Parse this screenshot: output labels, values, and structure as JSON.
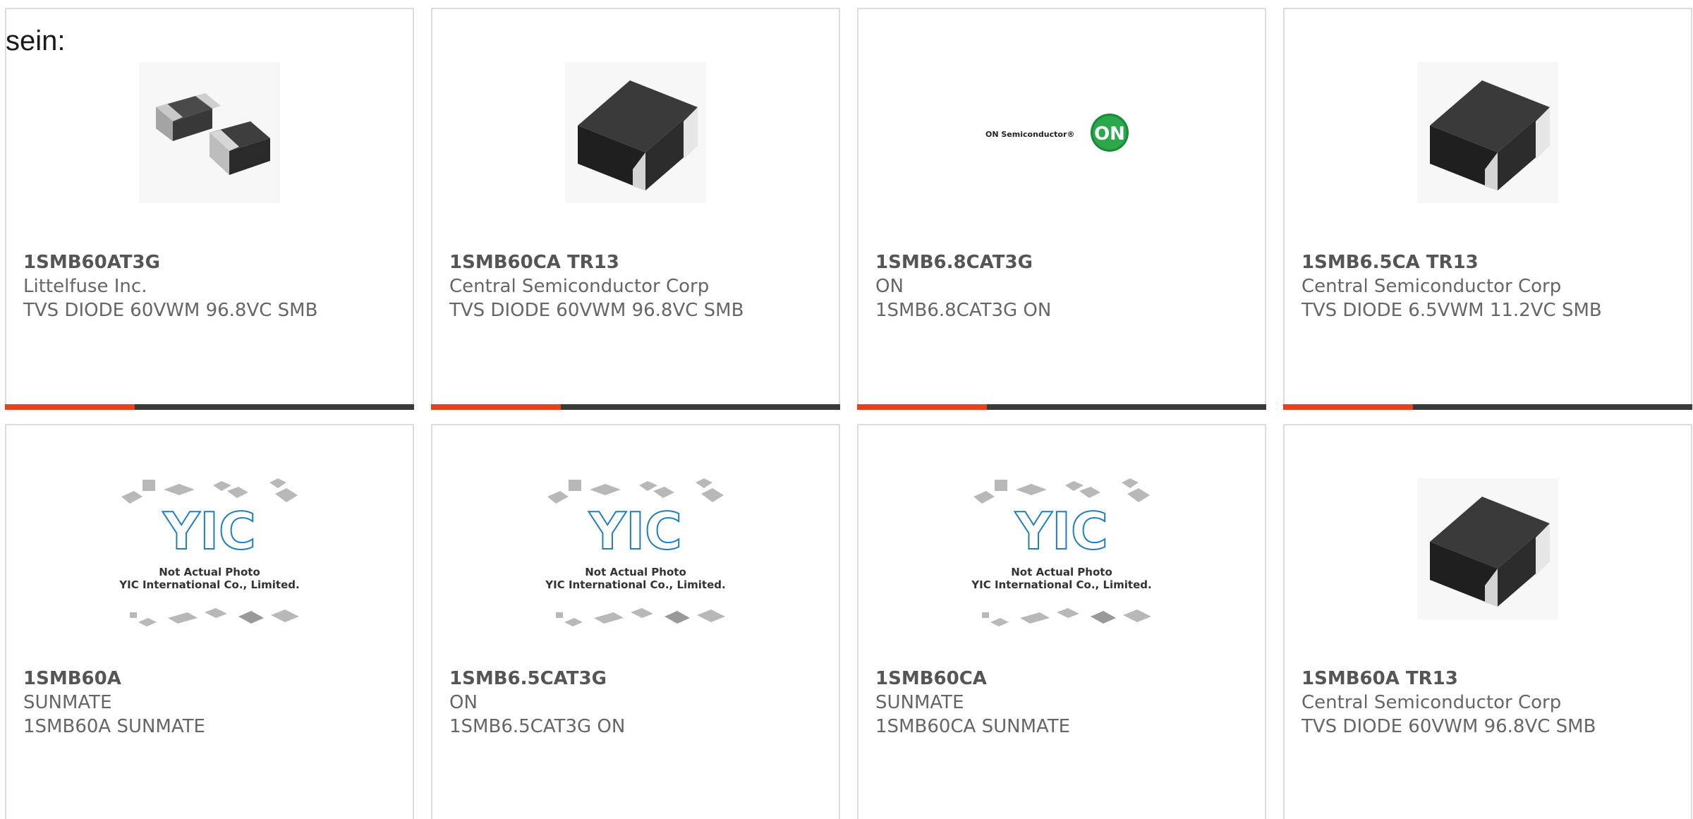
{
  "intro_text": "sein:",
  "products": [
    {
      "part_number": "1SMB60AT3G",
      "manufacturer": "Littelfuse Inc.",
      "description": "TVS DIODE 60VWM 96.8VC SMB",
      "image": "smb-diode-pair"
    },
    {
      "part_number": "1SMB60CA TR13",
      "manufacturer": "Central Semiconductor Corp",
      "description": "TVS DIODE 60VWM 96.8VC SMB",
      "image": "smb-diode-single"
    },
    {
      "part_number": "1SMB6.8CAT3G",
      "manufacturer": "ON",
      "description": "1SMB6.8CAT3G ON",
      "image": "on-semiconductor-logo",
      "logo_text": "ON Semiconductor®",
      "logo_badge": "ON"
    },
    {
      "part_number": "1SMB6.5CA TR13",
      "manufacturer": "Central Semiconductor Corp",
      "description": "TVS DIODE 6.5VWM 11.2VC SMB",
      "image": "smb-diode-single"
    },
    {
      "part_number": "1SMB60A",
      "manufacturer": "SUNMATE",
      "description": "1SMB60A SUNMATE",
      "image": "yic-placeholder"
    },
    {
      "part_number": "1SMB6.5CAT3G",
      "manufacturer": "ON",
      "description": "1SMB6.5CAT3G ON",
      "image": "yic-placeholder"
    },
    {
      "part_number": "1SMB60CA",
      "manufacturer": "SUNMATE",
      "description": "1SMB60CA SUNMATE",
      "image": "yic-placeholder"
    },
    {
      "part_number": "1SMB60A TR13",
      "manufacturer": "Central Semiconductor Corp",
      "description": "TVS DIODE 60VWM 96.8VC SMB",
      "image": "smb-diode-single"
    }
  ],
  "placeholder": {
    "logo_text": "YIC",
    "line1": "Not Actual Photo",
    "line2": "YIC International Co., Limited."
  },
  "colors": {
    "accent": "#e8401c",
    "bar": "#3a3a3a",
    "border": "#dcdcdc",
    "yic_blue": "#1f7fc1"
  }
}
